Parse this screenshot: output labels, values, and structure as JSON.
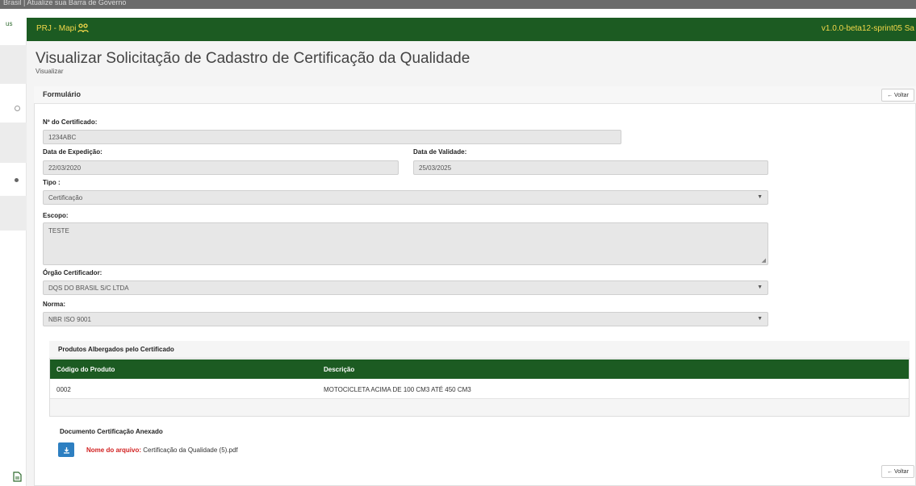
{
  "gov_bar": {
    "text": "Brasil  |  Atualize sua Barra de Governo"
  },
  "sidebar": {
    "top_label": "us",
    "doc_icon": "document-icon"
  },
  "topbar": {
    "brand": "PRJ - Mapi",
    "brand_icon": "people-icon",
    "version": "v1.0.0-beta12-sprint05  Sa"
  },
  "page": {
    "title": "Visualizar Solicitação de Cadastro de Certificação da Qualidade",
    "subtitle": "Visualizar"
  },
  "panel": {
    "title": "Formulário",
    "back_label": "← Voltar"
  },
  "form": {
    "cert_number": {
      "label": "Nº do Certificado:",
      "value": "1234ABC"
    },
    "issue_date": {
      "label": "Data de Expedição:",
      "value": "22/03/2020"
    },
    "valid_date": {
      "label": "Data de Validade:",
      "value": "25/03/2025"
    },
    "tipo": {
      "label": "Tipo :",
      "value": "Certificação"
    },
    "escopo": {
      "label": "Escopo:",
      "value": "TESTE"
    },
    "orgao": {
      "label": "Órgão Certificador:",
      "value": "DQS DO BRASIL S/C LTDA"
    },
    "norma": {
      "label": "Norma:",
      "value": "NBR ISO 9001"
    }
  },
  "products": {
    "title": "Produtos Albergados pelo Certificado",
    "columns": [
      "Código do Produto",
      "Descrição"
    ],
    "rows": [
      {
        "code": "0002",
        "description": "MOTOCICLETA ACIMA DE 100 CM3 ATÉ 450 CM3"
      }
    ]
  },
  "attachment": {
    "title": "Documento Certificação Anexado",
    "file_label": "Nome do arquivo:",
    "file_name": "Certificação da Qualidade (5).pdf",
    "download_icon": "download-icon"
  },
  "colors": {
    "brand_green": "#1c5b22",
    "brand_yellow": "#f3d84a",
    "download_blue": "#2d7fc1",
    "file_label_red": "#d11f1f"
  }
}
